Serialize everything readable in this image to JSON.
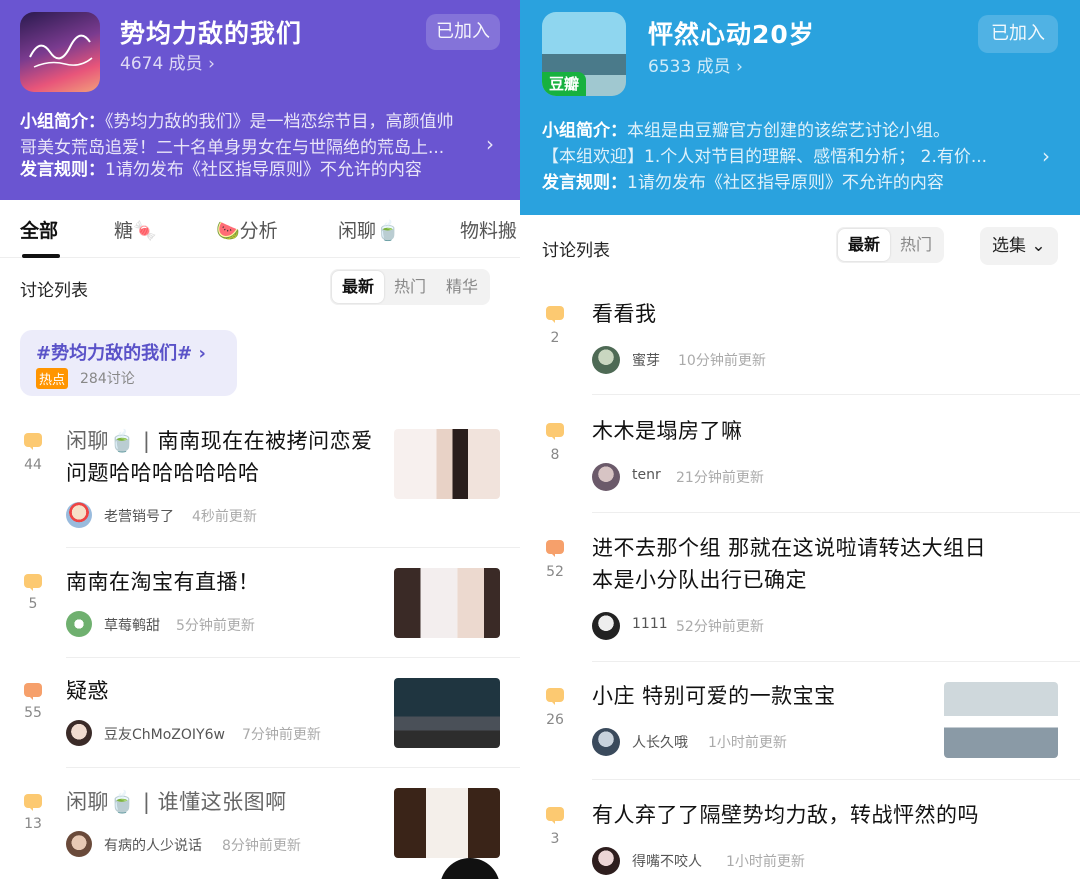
{
  "left": {
    "group": {
      "name": "势均力敌的我们",
      "members": "4674 成员",
      "joined": "已加入",
      "intro_label": "小组简介：",
      "intro_text": "《势均力敌的我们》是一档恋综节目，高颜值帅",
      "intro_text2": "哥美女荒岛追爱！二十名单身男女在与世隔绝的荒岛上...",
      "rules_label": "发言规则：",
      "rules_text": "1请勿发布《社区指导原则》不允许的内容"
    },
    "tabs": [
      "全部",
      "糖🍬",
      "🍉分析",
      "闲聊🍵",
      "物料搬"
    ],
    "list_header": "讨论列表",
    "sort": [
      "最新",
      "热门",
      "精华"
    ],
    "topic": {
      "title": "#势均力敌的我们#",
      "hot": "热点",
      "count": "284讨论"
    },
    "posts": [
      {
        "count": "44",
        "title1": "闲聊🍵",
        "title2": "南南现在在被拷问恋",
        "title3": "爱问题哈哈哈哈哈哈哈",
        "user": "老营销号了",
        "time": "4秒前更新"
      },
      {
        "count": "5",
        "title1": "南南在淘宝有直播！",
        "user": "草莓鹌甜",
        "time": "5分钟前更新"
      },
      {
        "count": "55",
        "title1": "疑惑",
        "user": "豆友ChMoZOIY6w",
        "time": "7分钟前更新"
      },
      {
        "count": "13",
        "title1": "闲聊🍵",
        "title2": "谁懂这张图啊",
        "user": "有病的人少说话",
        "time": "8分钟前更新"
      }
    ]
  },
  "right": {
    "group": {
      "name": "怦然心动20岁",
      "members": "6533 成员",
      "joined": "已加入",
      "badge": "豆瓣",
      "intro_label": "小组简介：",
      "intro_text": "本组是由豆瓣官方创建的该综艺讨论小组。",
      "intro_line2": "【本组欢迎】1.个人对节目的理解、感悟和分析； 2.有价...",
      "rules_label": "发言规则：",
      "rules_text": "1请勿发布《社区指导原则》不允许的内容"
    },
    "list_header": "讨论列表",
    "sort": [
      "最新",
      "热门"
    ],
    "select": "选集",
    "posts": [
      {
        "count": "2",
        "title1": "看看我",
        "user": "蜜芽",
        "time": "10分钟前更新"
      },
      {
        "count": "8",
        "title1": "木木是塌房了嘛",
        "user": "tenr",
        "time": "21分钟前更新"
      },
      {
        "count": "52",
        "title1": "进不去那个组 那就在这说啦请转达大组日",
        "title2": "本是小分队出行已确定",
        "user": "1111",
        "time": "52分钟前更新"
      },
      {
        "count": "26",
        "title1": "小庄 特别可爱的一款宝宝",
        "user": "人长久哦",
        "time": "1小时前更新"
      },
      {
        "count": "3",
        "title1": "有人弃了了隔壁势均力敌，转战怦然的吗",
        "user": "得嘴不咬人",
        "time": "1小时前更新"
      }
    ]
  },
  "colors": {
    "left_header": "#6a55d1",
    "right_header": "#2aa2de",
    "accent": "#5a52c8",
    "bubble": "#fcc971",
    "bubble_hot": "#f6a06b"
  }
}
